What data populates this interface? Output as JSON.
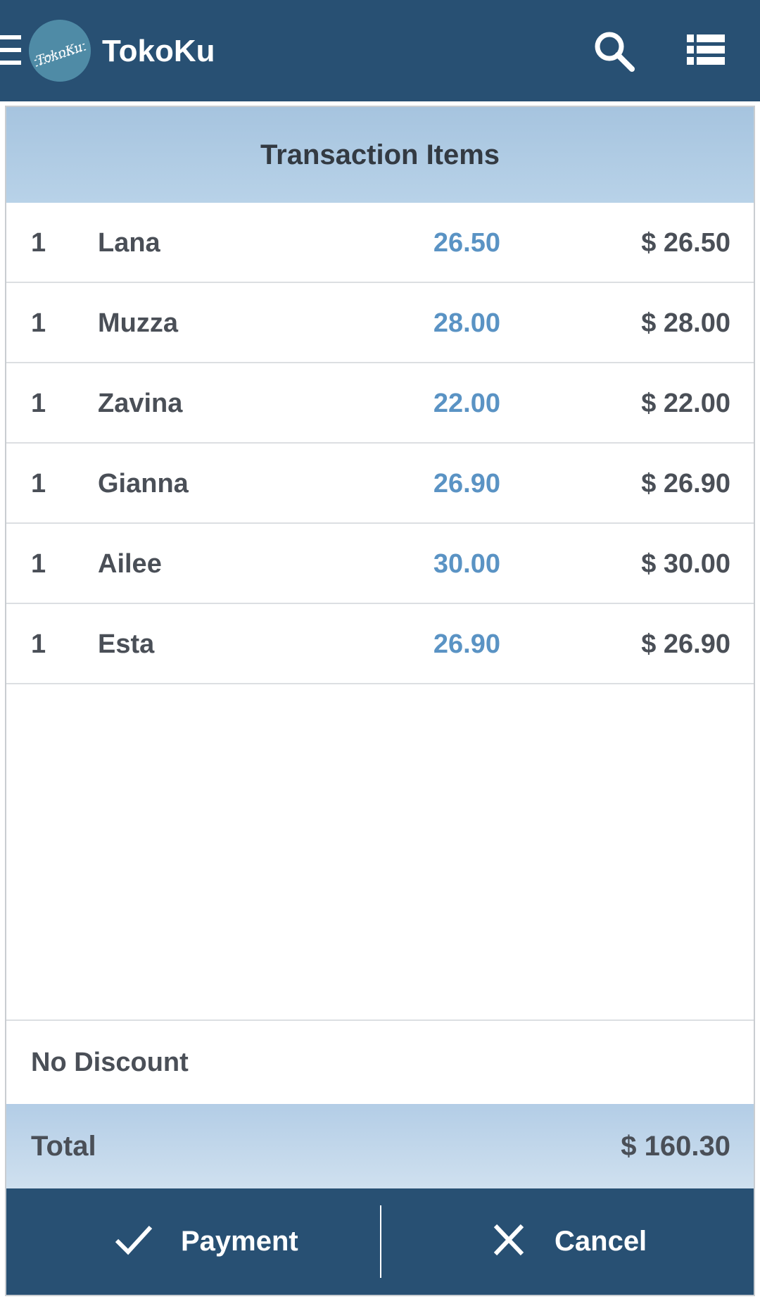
{
  "appbar": {
    "title": "TokoKu",
    "logo_text": "TokoKu",
    "icons": [
      "menu-icon",
      "search-icon",
      "list-view-icon"
    ],
    "color": "#285073"
  },
  "panel": {
    "header": "Transaction Items",
    "items": [
      {
        "qty": "1",
        "name": "Lana",
        "price": "26.50",
        "amount": "$ 26.50"
      },
      {
        "qty": "1",
        "name": "Muzza",
        "price": "28.00",
        "amount": "$ 28.00"
      },
      {
        "qty": "1",
        "name": "Zavina",
        "price": "22.00",
        "amount": "$ 22.00"
      },
      {
        "qty": "1",
        "name": "Gianna",
        "price": "26.90",
        "amount": "$ 26.90"
      },
      {
        "qty": "1",
        "name": "Ailee",
        "price": "30.00",
        "amount": "$ 30.00"
      },
      {
        "qty": "1",
        "name": "Esta",
        "price": "26.90",
        "amount": "$ 26.90"
      }
    ],
    "discount": "No Discount",
    "total_label": "Total",
    "total_value": "$ 160.30"
  },
  "actions": {
    "payment_label": "Payment",
    "payment_icon": "check-icon",
    "cancel_label": "Cancel",
    "cancel_icon": "close-icon"
  },
  "colors": {
    "primary": "#285073",
    "price_blue": "#5a93c4",
    "header_blue": "#a6c4df",
    "text_dark": "#4a4f57"
  }
}
